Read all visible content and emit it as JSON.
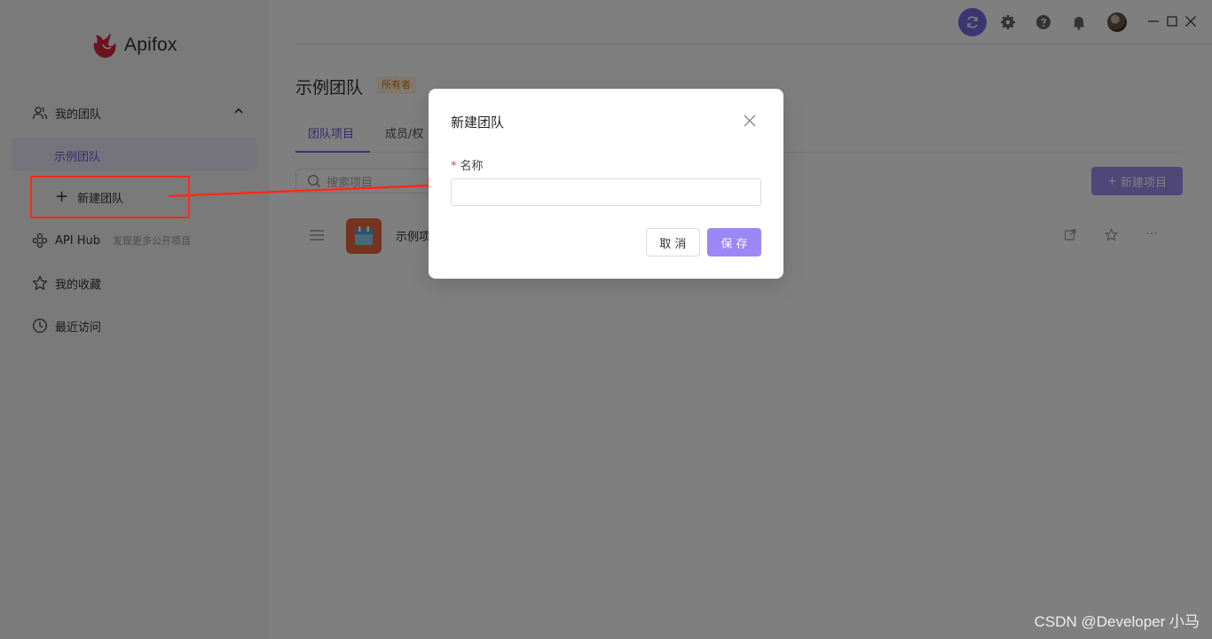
{
  "app": {
    "name": "Apifox"
  },
  "sidebar": {
    "my_team_label": "我的团队",
    "team_item": "示例团队",
    "new_team_label": "新建团队",
    "api_hub_label": "API Hub",
    "api_hub_sub": "发现更多公开项目",
    "favorites_label": "我的收藏",
    "recent_label": "最近访问"
  },
  "main": {
    "title": "示例团队",
    "owner_badge": "所有者",
    "tabs": [
      {
        "label": "团队项目",
        "active": true
      },
      {
        "label": "成员/权",
        "active": false
      }
    ],
    "search_placeholder": "搜索项目",
    "new_project_button": "新建项目",
    "projects": [
      {
        "name": "示例项"
      }
    ]
  },
  "modal": {
    "title": "新建团队",
    "field_required_mark": "*",
    "field_label": "名称",
    "field_value": "",
    "cancel_label": "取 消",
    "save_label": "保 存"
  },
  "colors": {
    "accent": "#7b6be2",
    "annotation_red": "#ff2a1a"
  },
  "watermark": "CSDN @Developer 小马"
}
